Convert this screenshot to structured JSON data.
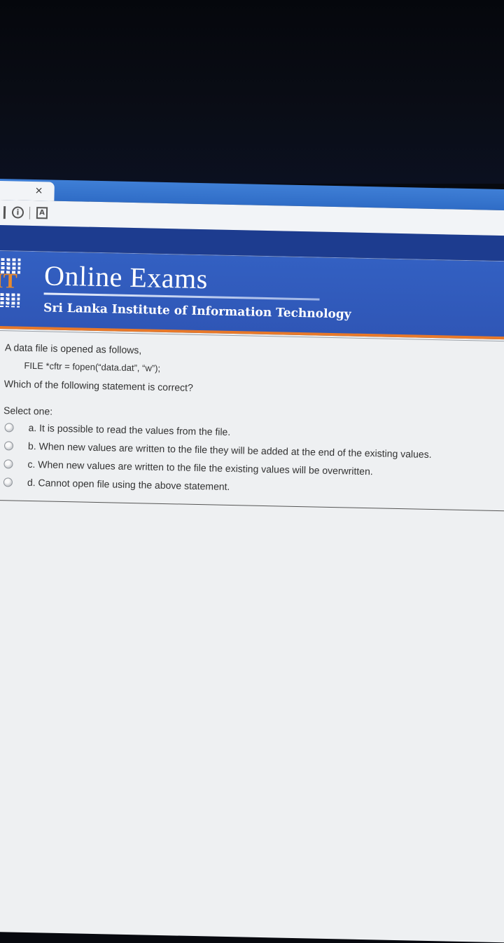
{
  "browser": {
    "tab_close": "×",
    "info_icon_glyph": "i",
    "reader_icon_glyph": "A"
  },
  "banner": {
    "logo_text": "IT",
    "title": "Online Exams",
    "subtitle": "Sri Lanka Institute of Information Technology"
  },
  "question": {
    "line1": "A data file is opened as follows,",
    "code": "FILE *cftr = fopen(“data.dat”, “w”);",
    "line2": "Which of the following statement is correct?",
    "select_prompt": "Select one:",
    "options": [
      {
        "label": "a. It is possible to read the values from the file."
      },
      {
        "label": "b. When new values are written to the file they will be added at the end of the existing values."
      },
      {
        "label": "c. When new values are written to the file the existing values will be overwritten."
      },
      {
        "label": "d. Cannot open file using the above statement."
      }
    ]
  },
  "colors": {
    "banner_blue": "#2f56b6",
    "accent_orange": "#e8792a",
    "tab_blue": "#3f7fd6"
  }
}
